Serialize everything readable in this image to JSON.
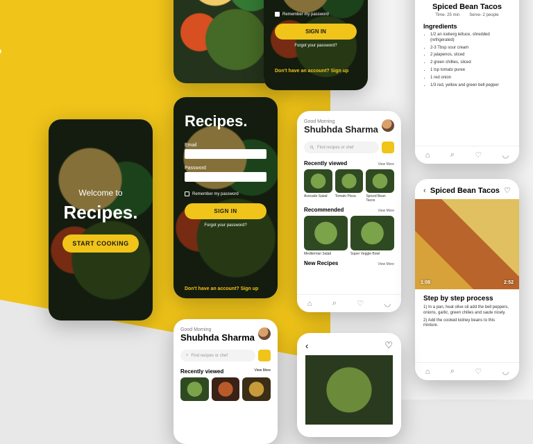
{
  "brand": "Recipes.",
  "colors": {
    "accent": "#f0c419",
    "bg": "#e8e8e8"
  },
  "welcome": {
    "supertitle": "Welcome to",
    "title": "Recipes.",
    "cta": "START COOKING"
  },
  "signin": {
    "logo": "Recipes.",
    "email_label": "Email",
    "password_label": "Password",
    "remember_label": "Remember my password",
    "button": "SIGN IN",
    "forgot": "Forgot your password?",
    "no_account": "Don't have an account? ",
    "signup": "Sign up"
  },
  "home": {
    "greeting": "Good Morning",
    "username": "Shubhda Sharma",
    "search_placeholder": "Find recipes or chef",
    "sections": {
      "recent": {
        "title": "Recently viewed",
        "more": "View More",
        "items": [
          "Avocado Salad",
          "Tomato Pizza",
          "Spiced Bean Tacos"
        ]
      },
      "recommended": {
        "title": "Recommended",
        "more": "View More",
        "items": [
          "Mediterrian Salad",
          "Super Veggie Bowl"
        ]
      },
      "new": {
        "title": "New Recipes",
        "more": "View More"
      }
    }
  },
  "recipe": {
    "title": "Spiced Bean Tacos",
    "time_label": "Time- 25 min",
    "serve_label": "Serve- 2 people",
    "ingredients_heading": "Ingredients",
    "ingredients": [
      "1/2 an iceberg lettuce, shredded (refrigerated)",
      "2-3 Tbsp sour cream",
      "2 jalapenos, sliced",
      "2 green chillies, sliced",
      "1 tsp tomato puree",
      "1 red onion",
      "1/3 red, yellow and green bell pepper"
    ]
  },
  "steps": {
    "title": "Spiced Bean Tacos",
    "time_left": "1:08",
    "time_right": "2:52",
    "heading": "Step by step process",
    "list": [
      "1) In a pan, heat olive oil add the bell peppers, onions, garlic, green chilies and saute nicely.",
      "2) Add the cooked kidney beans to this mixture."
    ]
  },
  "nav_icons": [
    "home-icon",
    "search-icon",
    "heart-icon",
    "user-icon"
  ]
}
